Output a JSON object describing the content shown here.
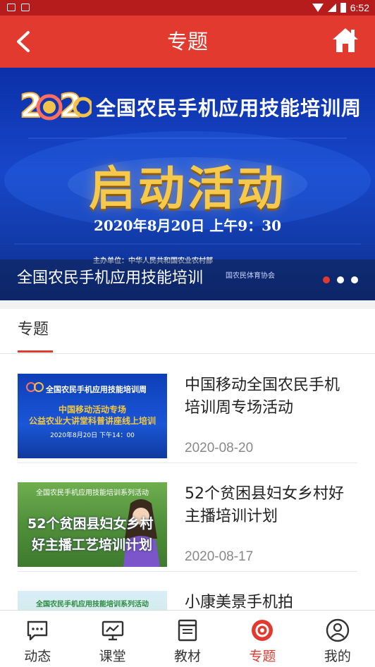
{
  "status_bar": {
    "time": "6:52"
  },
  "header": {
    "title": "专题",
    "back_icon": "chevron-left-icon",
    "home_icon": "home-icon"
  },
  "banner": {
    "heading": "全国农民手机应用技能培训周",
    "big_text": "启动活动",
    "date_line": "2020年8月20日 上午9：30",
    "host_line": "主办单位：中华人民共和国农业农村部",
    "org_line": "国农民体育协会",
    "caption": "全国农民手机应用技能培训",
    "dots": 3,
    "active_dot": 1
  },
  "section": {
    "tab_label": "专题"
  },
  "articles": [
    {
      "title": "中国移动全国农民手机培训周专场活动",
      "date": "2020-08-20",
      "thumb": {
        "heading": "全国农民手机应用技能培训周",
        "line1": "中国移动活动专场",
        "line2": "公益农业大讲堂科普讲座线上培训",
        "date": "2020年8月20日 下午14：00"
      }
    },
    {
      "title": "52个贫困县妇女乡村好主播培训计划",
      "date": "2020-08-17",
      "thumb": {
        "heading": "全国农民手机应用技能培训系列活动",
        "line1": "52个贫困县妇女乡村",
        "line2": "好主播工艺培训计划"
      }
    },
    {
      "title": "小康美景手机拍",
      "date": "",
      "thumb": {
        "heading": "全国农民手机应用技能培训系列活动"
      }
    }
  ],
  "bottom_nav": [
    {
      "label": "动态",
      "icon": "chat-bubble-icon",
      "active": false
    },
    {
      "label": "课堂",
      "icon": "monitor-chart-icon",
      "active": false
    },
    {
      "label": "教材",
      "icon": "book-icon",
      "active": false
    },
    {
      "label": "专题",
      "icon": "topic-circle-icon",
      "active": true
    },
    {
      "label": "我的",
      "icon": "user-icon",
      "active": false
    }
  ],
  "colors": {
    "primary": "#e23a2e",
    "status_bar": "#b71c1c",
    "banner_blue": "#1747c9",
    "gold": "#f7c94a"
  }
}
